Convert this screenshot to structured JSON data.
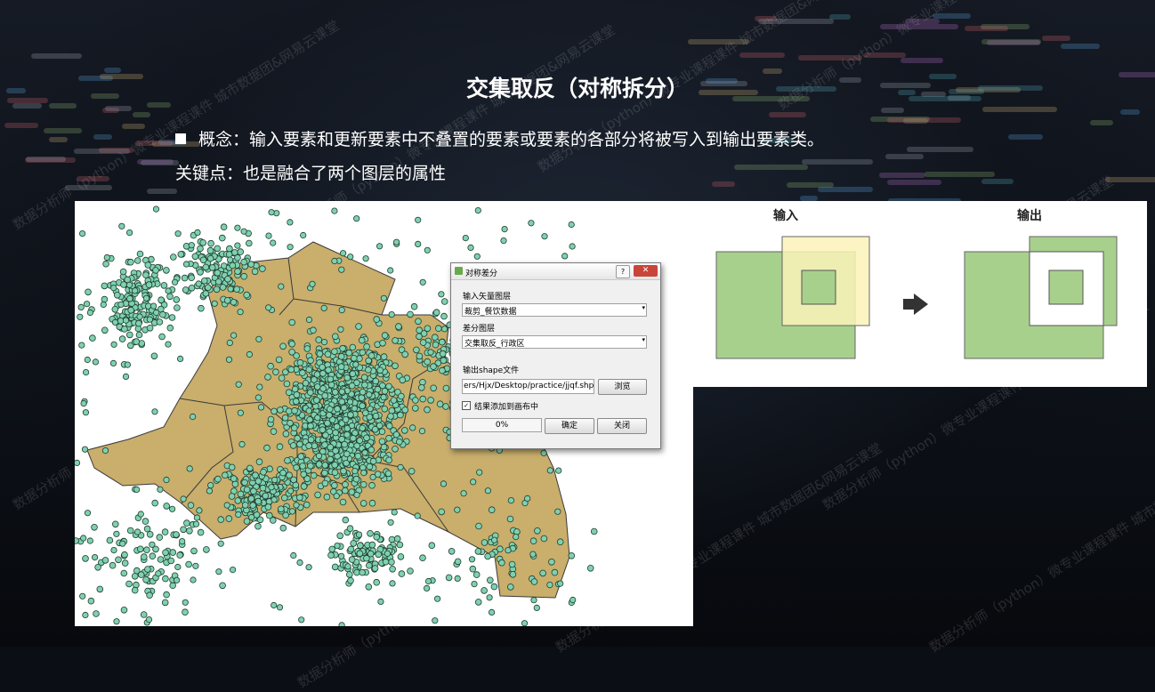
{
  "slide": {
    "title": "交集取反（对称拆分）",
    "bullet": "概念：输入要素和更新要素中不叠置的要素或要素的各部分将被写入到输出要素类。",
    "keypoint": "关键点：也是融合了两个图层的属性",
    "watermark": "数据分析师（python）微专业课程课件 城市数据团&网易云课堂"
  },
  "dialog": {
    "title": "对称差分",
    "help_label": "?",
    "close_label": "✕",
    "input_layer_label": "输入矢量图层",
    "input_layer_value": "裁剪_餐饮数据",
    "diff_layer_label": "差分图层",
    "diff_layer_value": "交集取反_行政区",
    "output_label": "输出shape文件",
    "output_path": "ers/Hjx/Desktop/practice/jjqf.shp",
    "browse_label": "浏览",
    "add_to_canvas_label": "结果添加到画布中",
    "add_to_canvas_checked": true,
    "progress": "0%",
    "ok_label": "确定",
    "close_button_label": "关闭"
  },
  "diagram": {
    "input_label": "输入",
    "output_label": "输出",
    "colors": {
      "green": "#a8d08d",
      "yellow": "#fbf3b8",
      "arrow": "#333333"
    }
  },
  "map": {
    "polygon_fill": "#c9ae6c",
    "point_fill": "#7fd1b0",
    "point_stroke": "#1f3d30"
  }
}
